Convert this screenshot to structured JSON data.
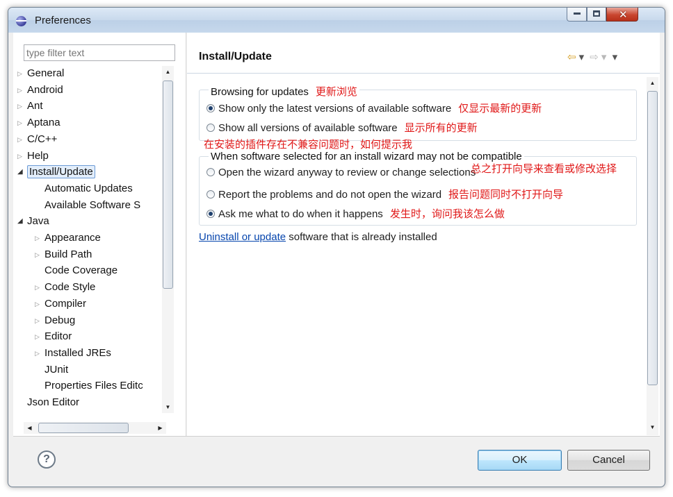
{
  "window": {
    "title": "Preferences"
  },
  "filter": {
    "placeholder": "type filter text"
  },
  "tree": [
    {
      "label": "General",
      "level": 0,
      "toggle": "closed"
    },
    {
      "label": "Android",
      "level": 0,
      "toggle": "closed"
    },
    {
      "label": "Ant",
      "level": 0,
      "toggle": "closed"
    },
    {
      "label": "Aptana",
      "level": 0,
      "toggle": "closed"
    },
    {
      "label": "C/C++",
      "level": 0,
      "toggle": "closed"
    },
    {
      "label": "Help",
      "level": 0,
      "toggle": "closed"
    },
    {
      "label": "Install/Update",
      "level": 0,
      "toggle": "open",
      "selected": true
    },
    {
      "label": "Automatic Updates",
      "level": 1,
      "toggle": "none"
    },
    {
      "label": "Available Software S",
      "level": 1,
      "toggle": "none"
    },
    {
      "label": "Java",
      "level": 0,
      "toggle": "open"
    },
    {
      "label": "Appearance",
      "level": 1,
      "toggle": "closed"
    },
    {
      "label": "Build Path",
      "level": 1,
      "toggle": "closed"
    },
    {
      "label": "Code Coverage",
      "level": 1,
      "toggle": "none"
    },
    {
      "label": "Code Style",
      "level": 1,
      "toggle": "closed"
    },
    {
      "label": "Compiler",
      "level": 1,
      "toggle": "closed"
    },
    {
      "label": "Debug",
      "level": 1,
      "toggle": "closed"
    },
    {
      "label": "Editor",
      "level": 1,
      "toggle": "closed"
    },
    {
      "label": "Installed JREs",
      "level": 1,
      "toggle": "closed"
    },
    {
      "label": "JUnit",
      "level": 1,
      "toggle": "none"
    },
    {
      "label": "Properties Files Editc",
      "level": 1,
      "toggle": "none"
    },
    {
      "label": "Json Editor",
      "level": 0,
      "toggle": "none"
    }
  ],
  "page": {
    "title": "Install/Update",
    "nav_back_glyph": "⇦",
    "nav_forward_glyph": "⇨",
    "dropdown_glyph": "▾",
    "browsing": {
      "label": "Browsing for updates",
      "annotation": "更新浏览",
      "options": [
        {
          "label": "Show only the latest versions of available software",
          "annotation": "仅显示最新的更新",
          "checked": true
        },
        {
          "label": "Show all versions of available software",
          "annotation": "显示所有的更新",
          "checked": false
        }
      ]
    },
    "compat_annotation": "在安装的插件存在不兼容问题时，如何提示我",
    "compat": {
      "label": "When software selected for an install wizard may not be compatible",
      "options": [
        {
          "label": "Open the wizard anyway to review or change selections",
          "annotation": "总之打开向导来查看或修改选择",
          "checked": false
        },
        {
          "label": "Report the problems and do not open the wizard",
          "annotation": "报告问题同时不打开向导",
          "checked": false
        },
        {
          "label": "Ask me what to do when it happens",
          "annotation": "发生时，询问我该怎么做",
          "checked": true
        }
      ]
    },
    "uninstall_link": "Uninstall or update",
    "uninstall_rest": " software that is already installed"
  },
  "buttons": {
    "help": "?",
    "ok": "OK",
    "cancel": "Cancel"
  },
  "colors": {
    "annotation": "#e01818",
    "link": "#0645ad",
    "selection": "#e3eefb"
  }
}
